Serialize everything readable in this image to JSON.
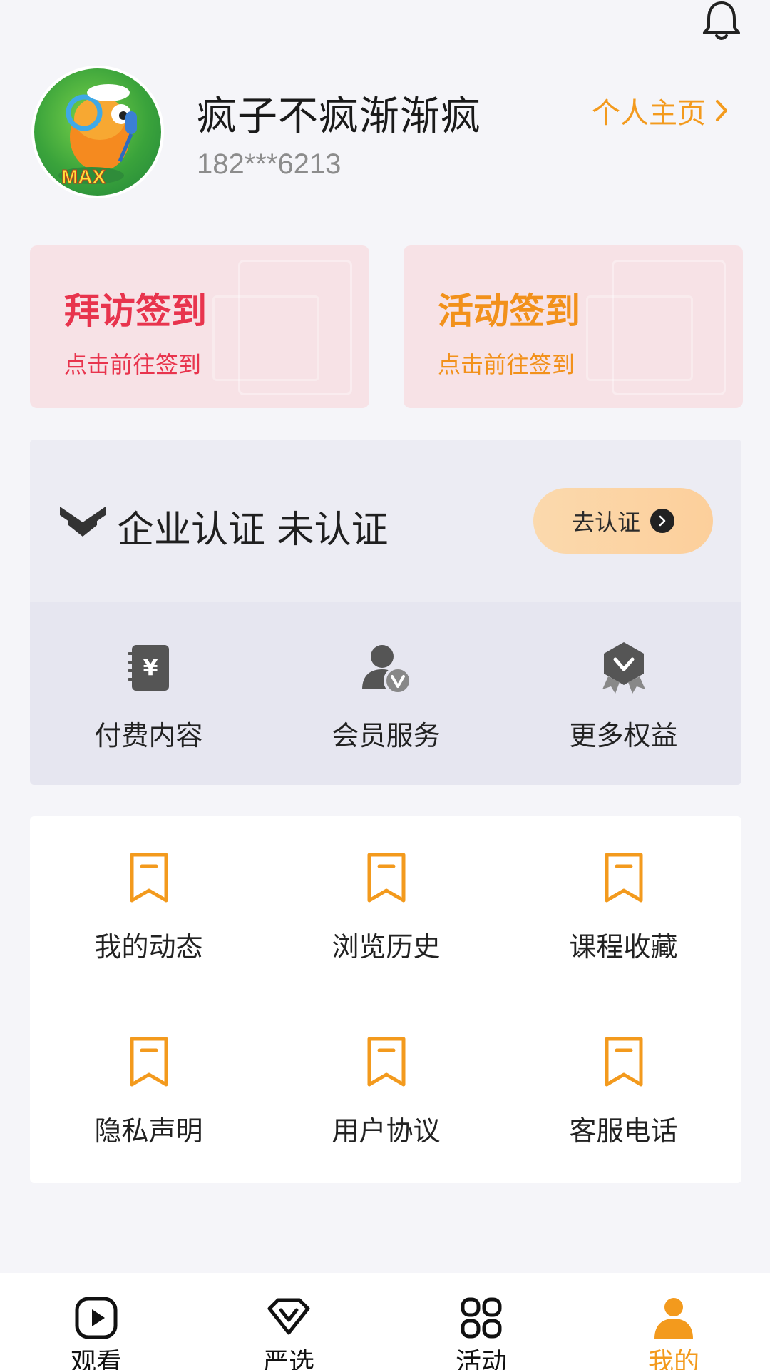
{
  "profile": {
    "name": "疯子不疯渐渐疯",
    "phone": "182***6213",
    "homepage_label": "个人主页",
    "avatar_text": "MAX"
  },
  "checkin": [
    {
      "title": "拜访签到",
      "subtitle": "点击前往签到",
      "color": "#e8344d"
    },
    {
      "title": "活动签到",
      "subtitle": "点击前往签到",
      "color": "#f2911b"
    }
  ],
  "certification": {
    "status_text": "企业认证 未认证",
    "button_label": "去认证"
  },
  "benefits": [
    {
      "label": "付费内容",
      "icon": "paid-content-icon"
    },
    {
      "label": "会员服务",
      "icon": "member-service-icon"
    },
    {
      "label": "更多权益",
      "icon": "more-benefits-icon"
    }
  ],
  "menu": [
    {
      "label": "我的动态",
      "icon": "bookmark-icon"
    },
    {
      "label": "浏览历史",
      "icon": "bookmark-icon"
    },
    {
      "label": "课程收藏",
      "icon": "bookmark-icon"
    },
    {
      "label": "隐私声明",
      "icon": "bookmark-icon"
    },
    {
      "label": "用户协议",
      "icon": "bookmark-icon"
    },
    {
      "label": "客服电话",
      "icon": "bookmark-icon"
    }
  ],
  "bottom_nav": [
    {
      "label": "观看",
      "icon": "play-icon",
      "active": false
    },
    {
      "label": "严选",
      "icon": "diamond-v-icon",
      "active": false
    },
    {
      "label": "活动",
      "icon": "grid-icon",
      "active": false
    },
    {
      "label": "我的",
      "icon": "person-icon",
      "active": true
    }
  ],
  "colors": {
    "accent": "#f39a1d",
    "visit_red": "#e8344d",
    "background": "#f5f5f9"
  }
}
